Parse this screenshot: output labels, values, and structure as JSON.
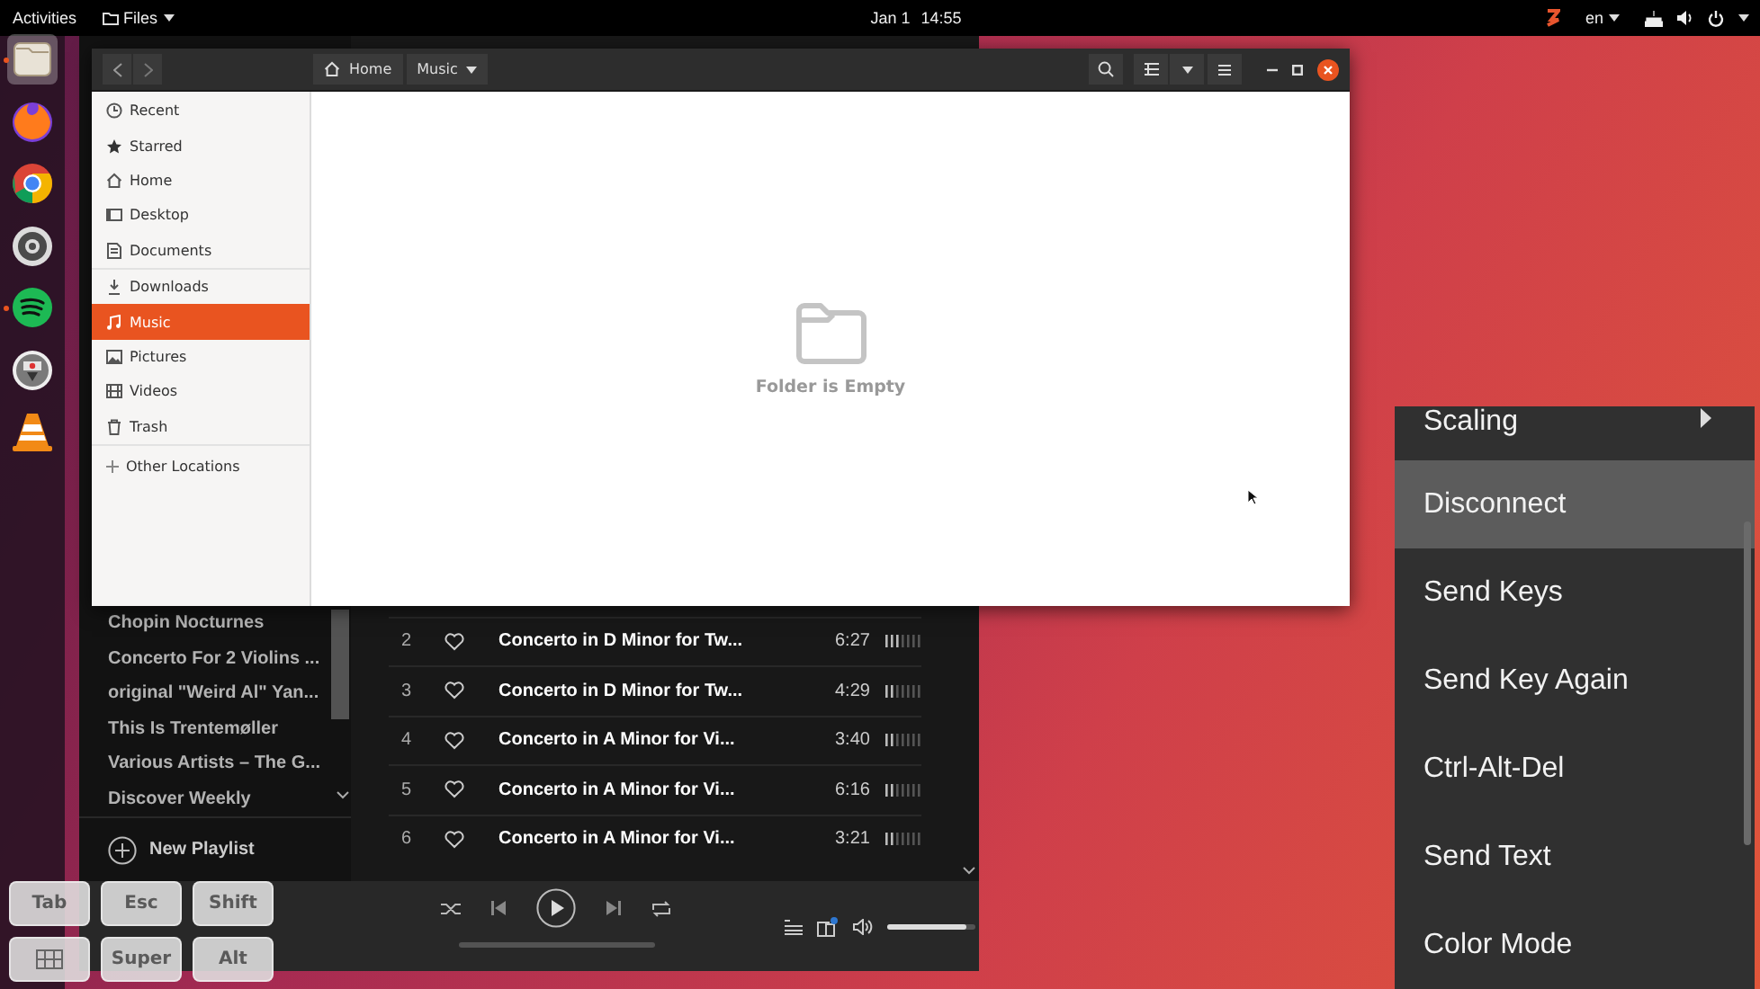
{
  "top_bar": {
    "activities": "Activities",
    "app_menu": "Files",
    "date": "Jan 1",
    "time": "14:55",
    "language": "en"
  },
  "dock": {
    "apps": [
      {
        "kind": "files",
        "running": true,
        "selected": true
      },
      {
        "kind": "firefox",
        "running": false,
        "selected": false
      },
      {
        "kind": "chrome",
        "running": false,
        "selected": false
      },
      {
        "kind": "settings",
        "running": false,
        "selected": false
      },
      {
        "kind": "spotify",
        "running": true,
        "selected": false
      },
      {
        "kind": "remote",
        "running": false,
        "selected": false
      },
      {
        "kind": "vlc",
        "running": false,
        "selected": false
      }
    ]
  },
  "spotify": {
    "playlists": [
      "Chopin Nocturnes",
      "Concerto For 2 Violins ...",
      "original \"Weird Al\" Yan...",
      "This Is Trentemøller",
      "Various Artists – The G...",
      "Discover Weekly"
    ],
    "new_playlist": "New Playlist",
    "tracks": [
      {
        "number": "2",
        "title": "Concerto in D Minor for Tw...",
        "duration": "6:27",
        "level": 0.43
      },
      {
        "number": "3",
        "title": "Concerto in D Minor for Tw...",
        "duration": "4:29",
        "level": 0.29
      },
      {
        "number": "4",
        "title": "Concerto in A Minor for Vi...",
        "duration": "3:40",
        "level": 0.29
      },
      {
        "number": "5",
        "title": "Concerto in A Minor for Vi...",
        "duration": "6:16",
        "level": 0.29
      },
      {
        "number": "6",
        "title": "Concerto in A Minor for Vi...",
        "duration": "3:21",
        "level": 0.29
      }
    ],
    "progress": {
      "level": 0
    },
    "volume": {
      "level": 0.9
    }
  },
  "files_window": {
    "path": [
      {
        "label": "Home",
        "kind": "home"
      },
      {
        "label": "Music",
        "kind": "current"
      }
    ],
    "sidebar": {
      "items": [
        {
          "label": "Recent",
          "kind": "recent",
          "selected": false
        },
        {
          "label": "Starred",
          "kind": "starred",
          "selected": false
        },
        {
          "label": "Home",
          "kind": "home",
          "selected": false
        },
        {
          "label": "Desktop",
          "kind": "desktop",
          "selected": false
        },
        {
          "label": "Documents",
          "kind": "documents",
          "selected": false
        },
        {
          "label": "Downloads",
          "kind": "downloads",
          "selected": false
        },
        {
          "label": "Music",
          "kind": "music",
          "selected": true
        },
        {
          "label": "Pictures",
          "kind": "pictures",
          "selected": false
        },
        {
          "label": "Videos",
          "kind": "videos",
          "selected": false
        },
        {
          "label": "Trash",
          "kind": "trash",
          "selected": false
        }
      ],
      "other_locations": "Other Locations"
    },
    "empty_text": "Folder is Empty"
  },
  "keyboard": {
    "keys": [
      {
        "kind": "text",
        "label": "Tab"
      },
      {
        "kind": "text",
        "label": "Esc"
      },
      {
        "kind": "text",
        "label": "Shift"
      },
      {
        "kind": "grid"
      },
      {
        "kind": "text",
        "label": "Super"
      },
      {
        "kind": "text",
        "label": "Alt"
      }
    ]
  },
  "menu": {
    "items": [
      {
        "label": "Scaling",
        "submenu": true,
        "selected": false
      },
      {
        "label": "Disconnect",
        "submenu": false,
        "selected": true
      },
      {
        "label": "Send Keys",
        "submenu": false,
        "selected": false
      },
      {
        "label": "Send Key Again",
        "submenu": false,
        "selected": false
      },
      {
        "label": "Ctrl-Alt-Del",
        "submenu": false,
        "selected": false
      },
      {
        "label": "Send Text",
        "submenu": false,
        "selected": false
      },
      {
        "label": "Color Mode",
        "submenu": false,
        "selected": false
      }
    ]
  }
}
